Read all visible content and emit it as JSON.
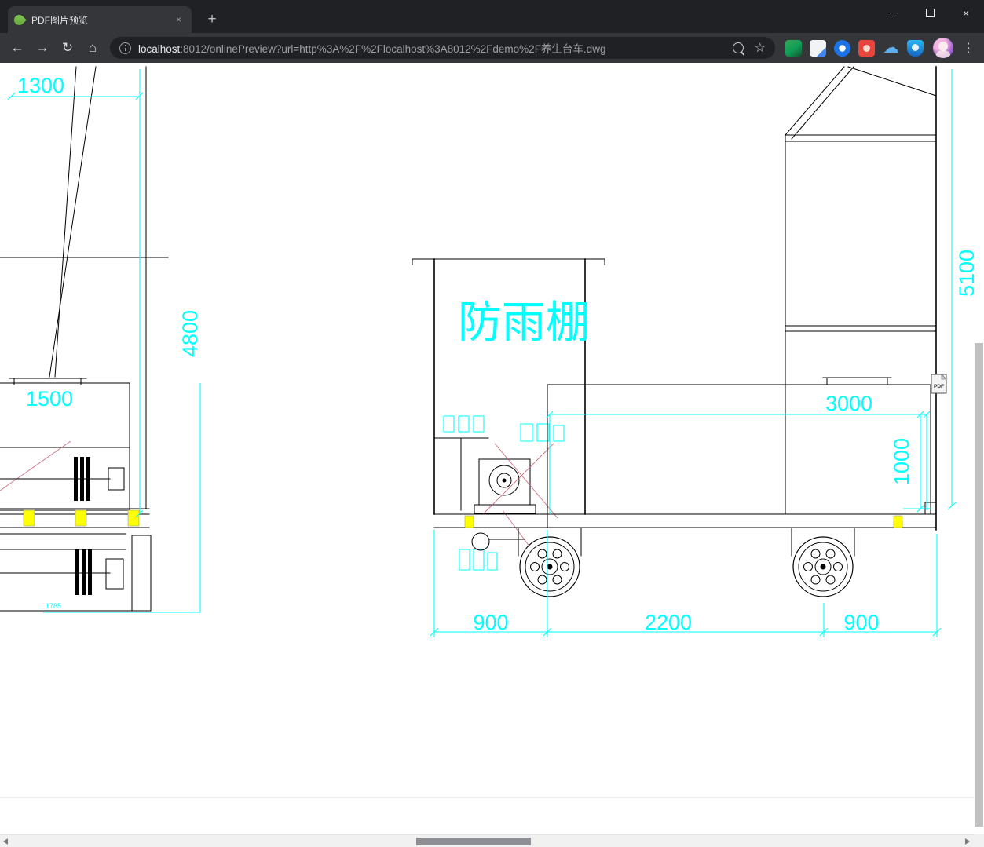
{
  "tab": {
    "title": "PDF图片预览"
  },
  "icons": {
    "back": "←",
    "forward": "→",
    "reload": "↻",
    "home": "⌂",
    "star": "☆",
    "menu": "⋮",
    "new_tab": "+",
    "close_tab": "×",
    "window_close": "×",
    "cloud": "☁"
  },
  "address": {
    "host": "localhost",
    "rest": ":8012/onlinePreview?url=http%3A%2F%2Flocalhost%3A8012%2Fdemo%2F养生台车.dwg"
  },
  "drawing": {
    "labels": {
      "shed": "防雨棚",
      "dim_1300": "1300",
      "dim_4800": "4800",
      "dim_1500": "1500",
      "dim_1785": "1785",
      "dim_5100": "5100",
      "dim_3000": "3000",
      "dim_1000": "1000",
      "dim_900_left": "900",
      "dim_2200": "2200",
      "dim_900_right": "900",
      "pdf_badge": "PDF"
    },
    "colors": {
      "dimension": "#00ffff",
      "line": "#000000",
      "highlight": "#ffff00",
      "construction": "#c2596b"
    }
  }
}
